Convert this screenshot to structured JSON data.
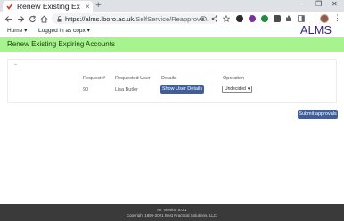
{
  "browser": {
    "tab_title": "Renew Existing Ex",
    "tab_close": "×",
    "new_tab": "+",
    "window_minimize": "−",
    "window_maximize": "❐",
    "window_close": "✕",
    "url_host": "https://alms.lboro.ac.uk",
    "url_path": "/SelfService/Reapprove..."
  },
  "app": {
    "nav": {
      "home": "Home ▾",
      "logged_in": "Logged in as copx ▾"
    },
    "brand": "ALMS",
    "page_title": "Renew Existing Expiring Accounts",
    "collapse_icon": "⌃",
    "table": {
      "headers": [
        "Request #",
        "Requested User",
        "Details",
        "Operation"
      ],
      "rows": [
        {
          "request_no": "90",
          "requested_user": "Lisa Butler",
          "details_button": "Show User Details",
          "operation": "Undecided"
        }
      ]
    },
    "submit_button": "Submit approvals",
    "footer": {
      "line1": "RT Version 5.0.1",
      "line2": "Copyright 1996-2021 Best Practical Solutions, LLC."
    }
  },
  "colors": {
    "banner": "#a8f28f",
    "brand": "#3b1f7a",
    "button": "#3f5f9c",
    "footer": "#3a3a3a"
  }
}
